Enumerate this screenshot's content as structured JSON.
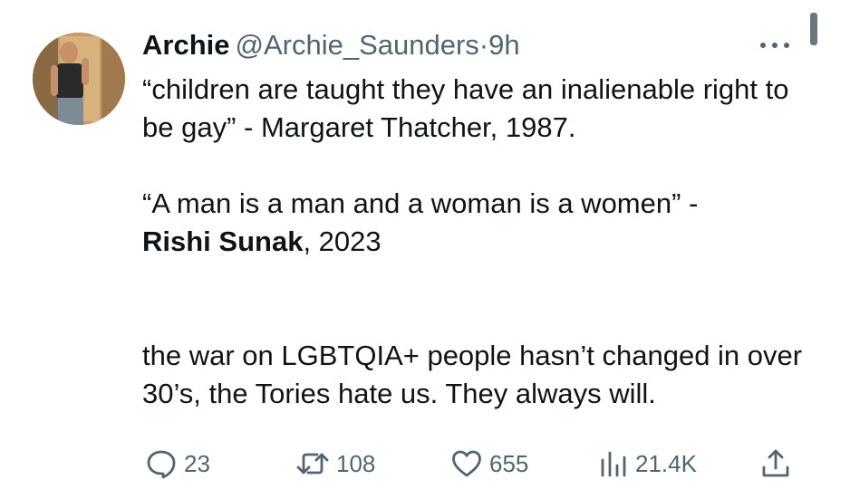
{
  "tweet": {
    "author": {
      "display_name": "Archie",
      "handle": "@Archie_Saunders",
      "separator": "·",
      "time": "9h"
    },
    "body": {
      "p1": "“children are taught they have an inalienable right to be gay” - Margaret Thatcher, 1987.",
      "p2_start": "“A man is a man and a woman is a women” -",
      "p2_bold": "Rishi Sunak",
      "p2_end": ", 2023",
      "p3": "the war on LGBTQIA+ people hasn’t changed in over 30’s, the Tories hate us. They always will."
    },
    "actions": {
      "replies": "23",
      "retweets": "108",
      "likes": "655",
      "views": "21.4K"
    },
    "icons": [
      "more-icon",
      "reply-icon",
      "retweet-icon",
      "like-icon",
      "views-icon",
      "share-icon"
    ],
    "colors": {
      "text": "#0f1419",
      "secondary": "#536471",
      "background": "#ffffff"
    }
  }
}
